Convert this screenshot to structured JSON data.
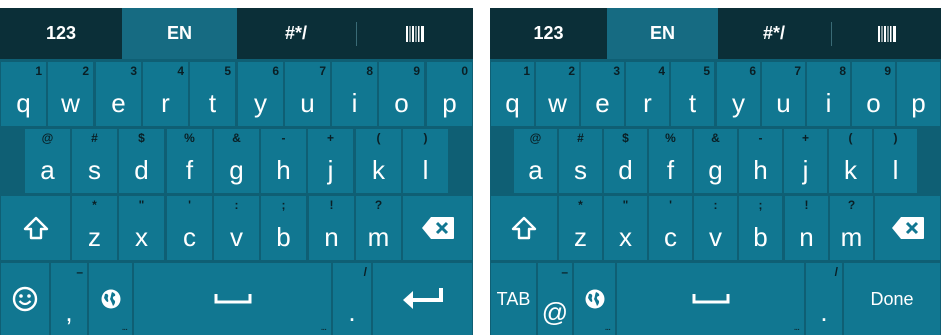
{
  "keyboard_left": {
    "tabs": [
      "123",
      "EN",
      "#*/",
      "||||||"
    ],
    "active_tab": "EN",
    "rows": {
      "row1": [
        [
          "q",
          "1"
        ],
        [
          "w",
          "2"
        ],
        [
          "e",
          "3"
        ],
        [
          "r",
          "4"
        ],
        [
          "t",
          "5"
        ],
        [
          "y",
          "6"
        ],
        [
          "u",
          "7"
        ],
        [
          "i",
          "8"
        ],
        [
          "o",
          "9"
        ],
        [
          "p",
          "0"
        ]
      ],
      "row2": [
        [
          "a",
          "@"
        ],
        [
          "s",
          "#"
        ],
        [
          "d",
          "$"
        ],
        [
          "f",
          "%"
        ],
        [
          "g",
          "&"
        ],
        [
          "h",
          "-"
        ],
        [
          "j",
          "+"
        ],
        [
          "k",
          "("
        ],
        [
          "l",
          ")"
        ]
      ],
      "row3": [
        [
          "z",
          "*"
        ],
        [
          "x",
          "\""
        ],
        [
          "c",
          "'"
        ],
        [
          "v",
          ":"
        ],
        [
          "b",
          ";"
        ],
        [
          "n",
          "!"
        ],
        [
          "m",
          "?"
        ]
      ]
    },
    "bottom": {
      "left_key": "smiley-icon",
      "comma": ",",
      "comma_sub": "–",
      "globe": "globe-icon",
      "space_dots": "...",
      "period": ".",
      "period_sub": "/",
      "action": "enter-icon"
    }
  },
  "keyboard_right": {
    "tabs": [
      "123",
      "EN",
      "#*/",
      "||||||"
    ],
    "active_tab": "EN",
    "rows": {
      "row1": [
        [
          "q",
          "1"
        ],
        [
          "w",
          "2"
        ],
        [
          "e",
          "3"
        ],
        [
          "r",
          "4"
        ],
        [
          "t",
          "5"
        ],
        [
          "y",
          "6"
        ],
        [
          "u",
          "7"
        ],
        [
          "i",
          "8"
        ],
        [
          "o",
          "9"
        ],
        [
          "p",
          ""
        ]
      ],
      "row2": [
        [
          "a",
          "@"
        ],
        [
          "s",
          "#"
        ],
        [
          "d",
          "$"
        ],
        [
          "f",
          "%"
        ],
        [
          "g",
          "&"
        ],
        [
          "h",
          "-"
        ],
        [
          "j",
          "+"
        ],
        [
          "k",
          "("
        ],
        [
          "l",
          ")"
        ]
      ],
      "row3": [
        [
          "z",
          "*"
        ],
        [
          "x",
          "\""
        ],
        [
          "c",
          "'"
        ],
        [
          "v",
          ":"
        ],
        [
          "b",
          ";"
        ],
        [
          "n",
          "!"
        ],
        [
          "m",
          "?"
        ]
      ]
    },
    "bottom": {
      "tab_label": "TAB",
      "at": "@",
      "at_sub": "–",
      "globe": "globe-icon",
      "space_dots": "...",
      "period": ".",
      "period_sub": "/",
      "action_label": "Done"
    }
  },
  "colors": {
    "keyboard_bg": "#0f5f74",
    "key_bg": "#117791",
    "topbar_bg": "#0b2f38",
    "active_tab_bg": "#166b82",
    "key_text": "#ffffff",
    "sub_text": "#0a1f25"
  }
}
